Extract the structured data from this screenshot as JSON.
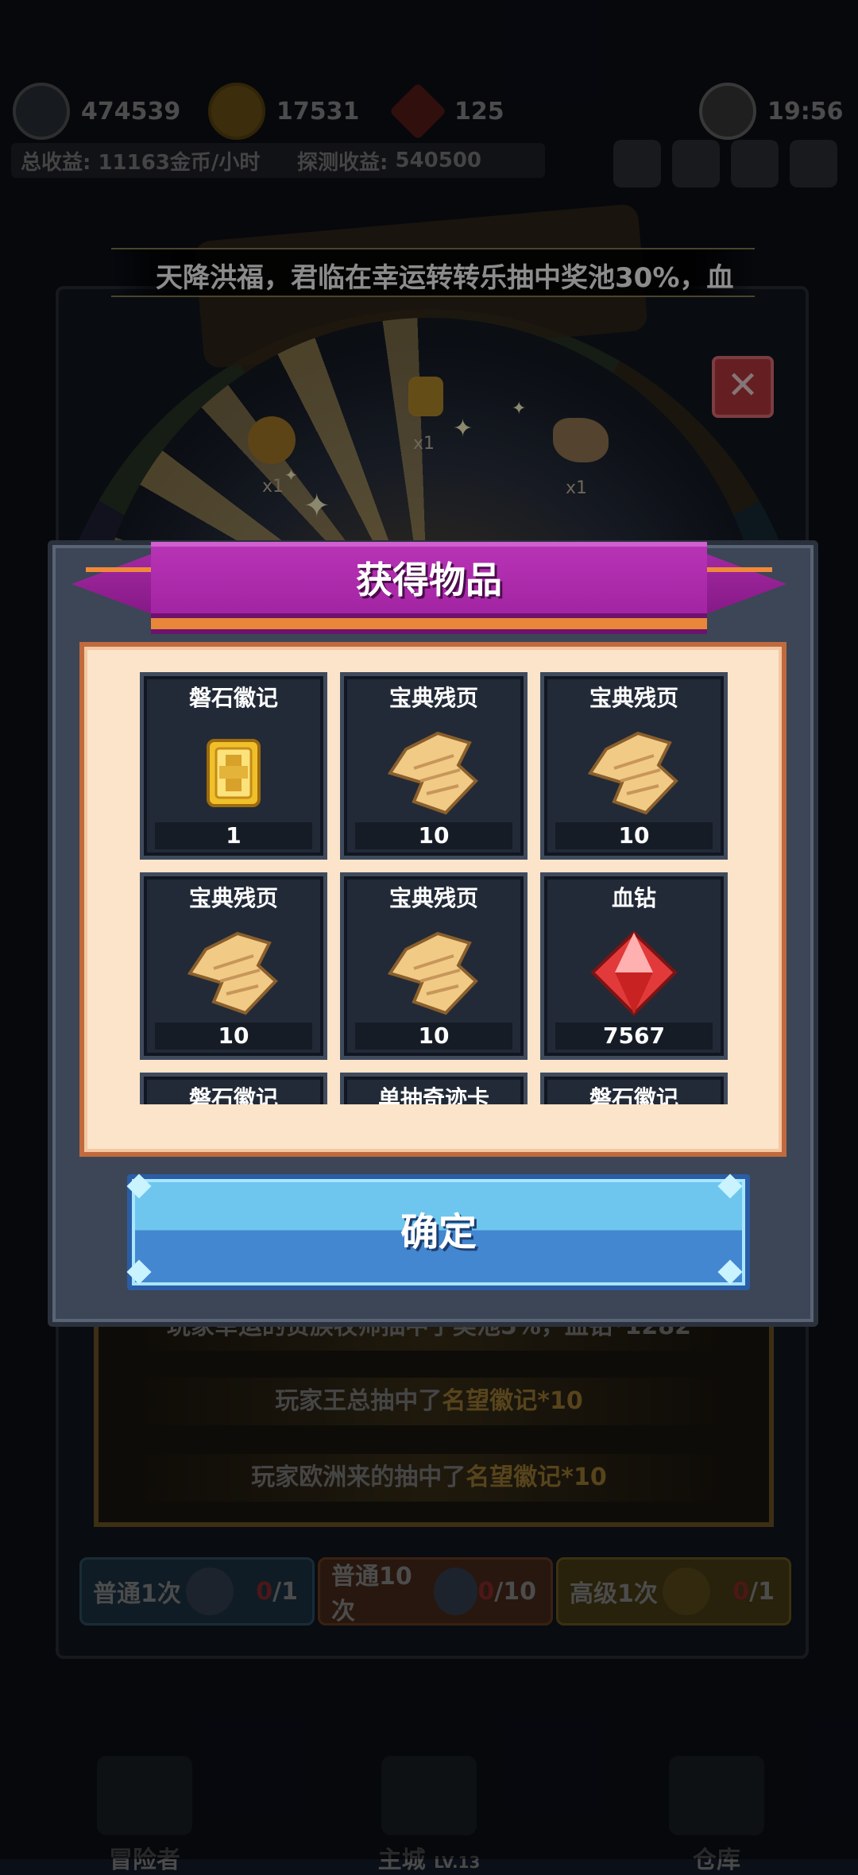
{
  "background": {
    "resources": [
      {
        "icon": "clock-medal-icon",
        "value": "474539"
      },
      {
        "icon": "gold-coin-icon",
        "value": "17531"
      },
      {
        "icon": "red-gem-icon",
        "value": "125"
      },
      {
        "icon": "timer-icon",
        "value": "19:56"
      }
    ],
    "income": [
      {
        "label": "总收益:",
        "value": "11163金币/小时"
      },
      {
        "label": "探测收益:",
        "value": "540500"
      }
    ],
    "broadcast": "天降洪福，君临在幸运转转乐抽中奖池30%，血",
    "wheel_items": [
      {
        "icon": "gold-badge-icon",
        "qty": "x1"
      },
      {
        "icon": "gear-badge-icon",
        "qty": "x1"
      },
      {
        "icon": "scroll-icon",
        "qty": "x1"
      }
    ],
    "log": [
      {
        "prefix": "玩家幸运的贵族牧师抽中了奖池5%，血钻*1282",
        "highlight": ""
      },
      {
        "prefix": "玩家王总抽中了",
        "highlight": "名望徽记*10"
      },
      {
        "prefix": "玩家欧洲来的抽中了",
        "highlight": "名望徽记*10"
      }
    ],
    "draw_buttons": [
      {
        "label": "普通1次",
        "count_used": "0",
        "count_total": "/1"
      },
      {
        "label": "普通10次",
        "count_used": "0",
        "count_total": "/10"
      },
      {
        "label": "高级1次",
        "count_used": "0",
        "count_total": "/1"
      }
    ],
    "nav": [
      {
        "label": "冒险者"
      },
      {
        "label": "主城",
        "sub": "LV.13"
      },
      {
        "label": "仓库"
      }
    ]
  },
  "modal": {
    "title": "获得物品",
    "items": [
      {
        "name": "磐石徽记",
        "count": "1",
        "icon": "stone-emblem-icon"
      },
      {
        "name": "宝典残页",
        "count": "10",
        "icon": "scroll-fragment-icon"
      },
      {
        "name": "宝典残页",
        "count": "10",
        "icon": "scroll-fragment-icon"
      },
      {
        "name": "宝典残页",
        "count": "10",
        "icon": "scroll-fragment-icon"
      },
      {
        "name": "宝典残页",
        "count": "10",
        "icon": "scroll-fragment-icon"
      },
      {
        "name": "血钻",
        "count": "7567",
        "icon": "red-diamond-icon"
      },
      {
        "name": "磐石徽记",
        "count": "",
        "icon": "stone-emblem-icon"
      },
      {
        "name": "单抽奇迹卡",
        "count": "",
        "icon": "miracle-card-icon"
      },
      {
        "name": "磐石徽记",
        "count": "",
        "icon": "stone-emblem-icon"
      }
    ],
    "confirm_label": "确定"
  },
  "colors": {
    "ribbon": "#a526a5",
    "panel_bg": "#fbe4c9",
    "confirm_top": "#6ec6ee",
    "confirm_bottom": "#4287cf",
    "slot_bg": "#222a37"
  }
}
